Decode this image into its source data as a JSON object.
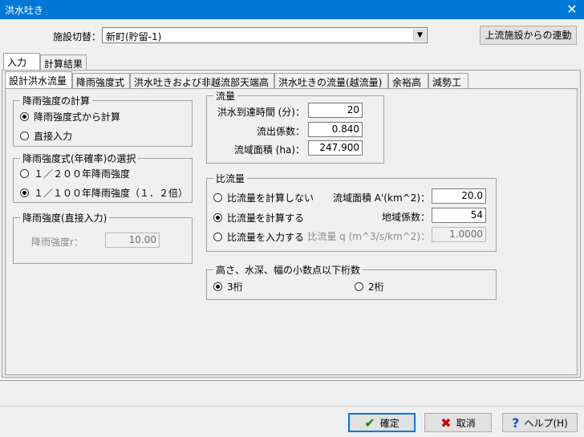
{
  "window": {
    "title": "洪水吐き",
    "close_glyph": "✕"
  },
  "header": {
    "facility_label": "施設切替：",
    "facility_value": "新町(貯留-1)",
    "upstream_button": "上流施設からの連動"
  },
  "outer_tabs": [
    "入力",
    "計算結果"
  ],
  "inner_tabs": [
    "設計洪水流量",
    "降雨強度式",
    "洪水吐きおよび非越流部天端高",
    "洪水吐きの流量(越流量)",
    "余裕高",
    "減勢工"
  ],
  "rain_calc": {
    "title": "降雨強度の計算",
    "options": [
      "降雨強度式から計算",
      "直接入力"
    ],
    "selected": 0
  },
  "rain_formula": {
    "title": "降雨強度式(年確率)の選択",
    "options": [
      "１／２００年降雨強度",
      "１／１００年降雨強度（１．２倍）"
    ],
    "selected": 1
  },
  "rain_direct": {
    "title": "降雨強度(直接入力)",
    "label": "降雨強度r：",
    "value": "10.00"
  },
  "flow": {
    "title": "流量",
    "fields": [
      {
        "label": "洪水到達時間 (分)：",
        "value": "20"
      },
      {
        "label": "流出係数：",
        "value": "0.840"
      },
      {
        "label": "流域面積 (ha)：",
        "value": "247.900"
      }
    ]
  },
  "specific_flow": {
    "title": "比流量",
    "options": [
      "比流量を計算しない",
      "比流量を計算する",
      "比流量を入力する"
    ],
    "selected": 1,
    "fields": [
      {
        "label": "流域面積 A'(km^2)：",
        "value": "20.0"
      },
      {
        "label": "地域係数：",
        "value": "54"
      },
      {
        "label": "比流量 q (m^3/s/km^2)：",
        "value": "1.0000"
      }
    ]
  },
  "decimals": {
    "title": "高さ、水深、幅の小数点以下桁数",
    "options": [
      "3桁",
      "2桁"
    ],
    "selected": 0
  },
  "footer": {
    "ok": "確定",
    "cancel": "取消",
    "help": "ヘルプ(H)"
  }
}
